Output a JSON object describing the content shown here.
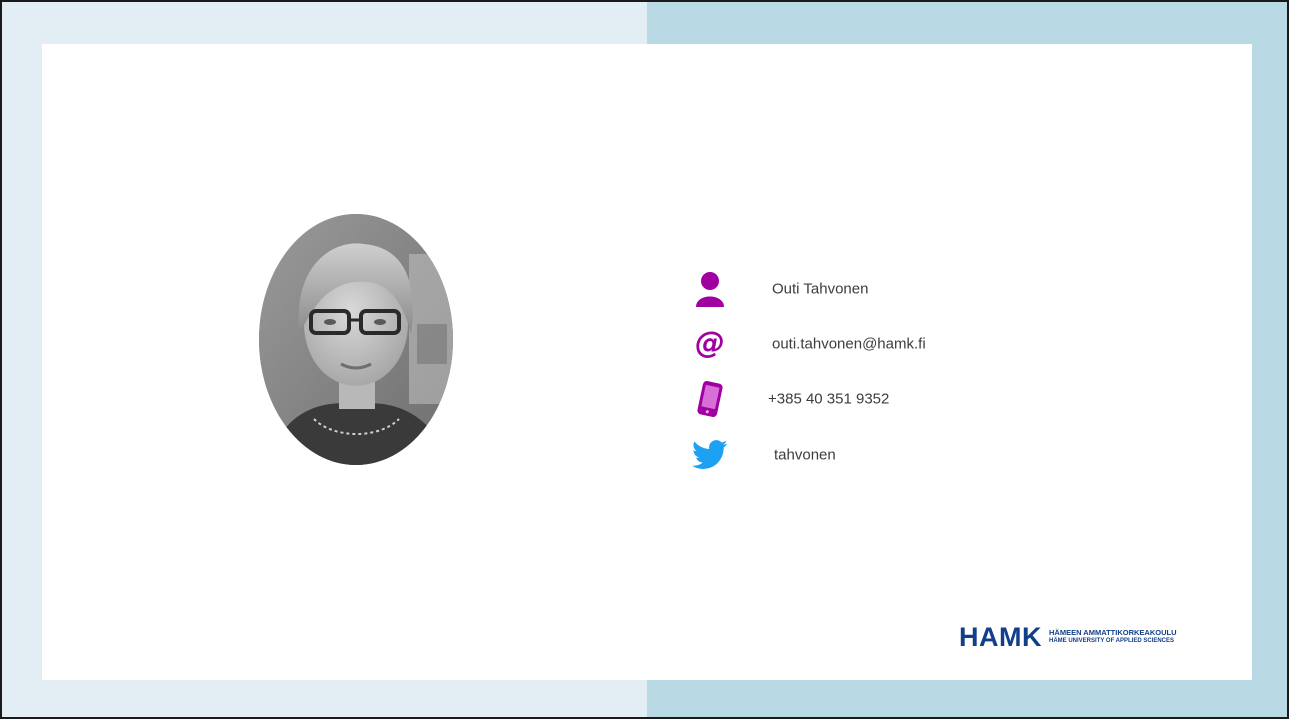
{
  "contact": {
    "name": "Outi Tahvonen",
    "email": "outi.tahvonen@hamk.fi",
    "phone": "+385 40 351 9352",
    "twitter": "tahvonen"
  },
  "icons": {
    "name": "person-icon",
    "email": "at-sign-icon",
    "phone": "mobile-phone-icon",
    "twitter": "twitter-bird-icon"
  },
  "logo": {
    "mark": "HAMK",
    "line1": "HÄMEEN AMMATTIKORKEAKOULU",
    "line2": "HÄME UNIVERSITY OF APPLIED SCIENCES"
  },
  "colors": {
    "accent": "#a000a0",
    "twitter": "#1da1f2",
    "brand": "#123f8a",
    "background_left": "#e2eef4",
    "background_right": "#b9d9e5"
  }
}
